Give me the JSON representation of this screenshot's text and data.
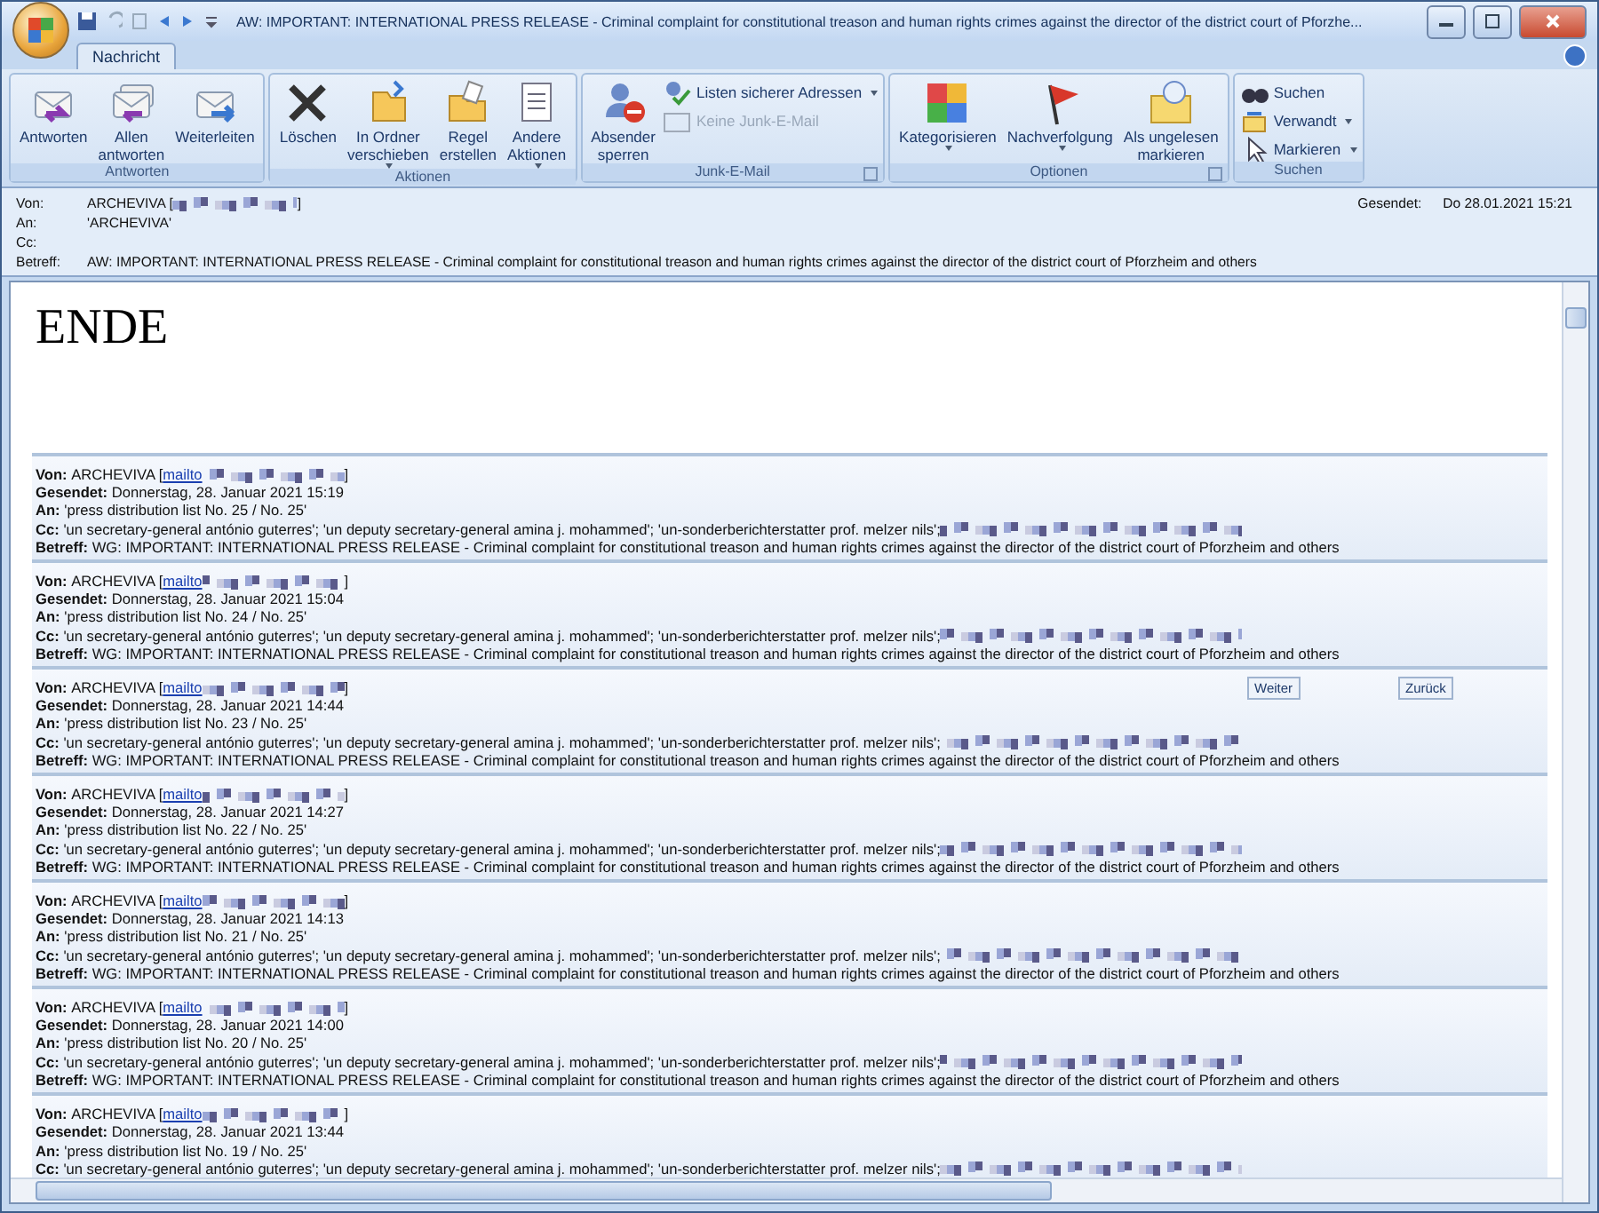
{
  "window": {
    "title": "AW: IMPORTANT:  INTERNATIONAL PRESS RELEASE  -  Criminal complaint for constitutional treason and human rights crimes against the director of the district court of Pforzhe..."
  },
  "tabs": [
    {
      "label": "Nachricht",
      "selected": true
    }
  ],
  "ribbon": [
    {
      "label": "Antworten",
      "launcher": false,
      "buttons": [
        {
          "kind": "reply",
          "label": "Antworten",
          "menu": false,
          "disabled": false
        },
        {
          "kind": "reply-all",
          "label": "Allen\nantworten",
          "menu": false,
          "disabled": false
        },
        {
          "kind": "forward",
          "label": "Weiterleiten",
          "menu": false,
          "disabled": false
        }
      ]
    },
    {
      "label": "Aktionen",
      "launcher": false,
      "buttons": [
        {
          "kind": "delete",
          "label": "Löschen",
          "menu": false,
          "disabled": false
        },
        {
          "kind": "move",
          "label": "In Ordner\nverschieben",
          "menu": true,
          "disabled": false
        },
        {
          "kind": "rule",
          "label": "Regel\nerstellen",
          "menu": false,
          "disabled": false
        },
        {
          "kind": "other",
          "label": "Andere\nAktionen",
          "menu": true,
          "disabled": false
        }
      ]
    },
    {
      "label": "Junk-E-Mail",
      "launcher": true,
      "buttons": [
        {
          "kind": "block",
          "label": "Absender\nsperren",
          "menu": false,
          "disabled": false
        }
      ],
      "small": [
        {
          "kind": "safe",
          "label": "Listen sicherer Adressen",
          "menu": true,
          "disabled": false
        },
        {
          "kind": "notjunk",
          "label": "Keine Junk-E-Mail",
          "menu": false,
          "disabled": true
        }
      ]
    },
    {
      "label": "Optionen",
      "launcher": true,
      "buttons": [
        {
          "kind": "categorize",
          "label": "Kategorisieren",
          "menu": true,
          "disabled": false
        },
        {
          "kind": "flag",
          "label": "Nachverfolgung",
          "menu": true,
          "disabled": false
        },
        {
          "kind": "unread",
          "label": "Als ungelesen\nmarkieren",
          "menu": false,
          "disabled": false
        }
      ]
    },
    {
      "label": "Suchen",
      "launcher": false,
      "small": [
        {
          "kind": "find",
          "label": "Suchen",
          "menu": false,
          "disabled": false
        },
        {
          "kind": "related",
          "label": "Verwandt",
          "menu": true,
          "disabled": false
        },
        {
          "kind": "select",
          "label": "Markieren",
          "menu": true,
          "disabled": false
        }
      ]
    }
  ],
  "header": {
    "from_label": "Von:",
    "from": "ARCHEVIVA [",
    "from_end": "]",
    "to_label": "An:",
    "to": "'ARCHEVIVA'",
    "cc_label": "Cc:",
    "subject_label": "Betreff:",
    "subject": "AW: IMPORTANT:  INTERNATIONAL PRESS RELEASE  -  Criminal complaint for constitutional treason and human rights crimes against the director of the district court of Pforzheim and others",
    "sent_label": "Gesendet:",
    "sent": "Do 28.01.2021 15:21"
  },
  "body_heading": "ENDE",
  "nav_buttons": [
    "Weiter",
    "Zurück"
  ],
  "messages": [
    {
      "from_label": "Von:",
      "from": "ARCHEVIVA [",
      "link": "mailto",
      "from_end": "]",
      "sent_label": "Gesendet:",
      "sent": "Donnerstag, 28. Januar 2021 15:19",
      "to_label": "An:",
      "to": "'press distribution list No. 25 / No. 25'",
      "cc_label": "Cc:",
      "cc": "'un secretary-general antónio guterres'; 'un deputy secretary-general amina j. mohammed'; 'un-sonderberichterstatter prof. melzer nils';",
      "subject_label": "Betreff:",
      "subject": "WG: IMPORTANT: INTERNATIONAL PRESS RELEASE - Criminal complaint for constitutional treason and human rights crimes against the director of the district court of Pforzheim and others"
    },
    {
      "from_label": "Von:",
      "from": "ARCHEVIVA [",
      "link": "mailto",
      "from_end": "]",
      "sent_label": "Gesendet:",
      "sent": "Donnerstag, 28. Januar 2021 15:04",
      "to_label": "An:",
      "to": "'press distribution list No. 24 / No. 25'",
      "cc_label": "Cc:",
      "cc": "'un secretary-general antónio guterres'; 'un deputy secretary-general amina j. mohammed'; 'un-sonderberichterstatter prof. melzer nils';",
      "subject_label": "Betreff:",
      "subject": "WG: IMPORTANT: INTERNATIONAL PRESS RELEASE - Criminal complaint for constitutional treason and human rights crimes against the director of the district court of Pforzheim and others"
    },
    {
      "from_label": "Von:",
      "from": "ARCHEVIVA [",
      "link": "mailto",
      "from_end": "]",
      "sent_label": "Gesendet:",
      "sent": "Donnerstag, 28. Januar 2021 14:44",
      "to_label": "An:",
      "to": "'press distribution list No. 23 / No. 25'",
      "cc_label": "Cc:",
      "cc": "'un secretary-general antónio guterres'; 'un deputy secretary-general amina j. mohammed'; 'un-sonderberichterstatter prof. melzer nils';",
      "subject_label": "Betreff:",
      "subject": "WG: IMPORTANT: INTERNATIONAL PRESS RELEASE - Criminal complaint for constitutional treason and human rights crimes against the director of the district court of Pforzheim and others"
    },
    {
      "from_label": "Von:",
      "from": "ARCHEVIVA [",
      "link": "mailto",
      "from_end": "]",
      "sent_label": "Gesendet:",
      "sent": "Donnerstag, 28. Januar 2021 14:27",
      "to_label": "An:",
      "to": "'press distribution list No. 22 / No. 25'",
      "cc_label": "Cc:",
      "cc": "'un secretary-general antónio guterres'; 'un deputy secretary-general amina j. mohammed'; 'un-sonderberichterstatter prof. melzer nils';",
      "subject_label": "Betreff:",
      "subject": "WG: IMPORTANT: INTERNATIONAL PRESS RELEASE - Criminal complaint for constitutional treason and human rights crimes against the director of the district court of Pforzheim and others"
    },
    {
      "from_label": "Von:",
      "from": "ARCHEVIVA [",
      "link": "mailto",
      "from_end": "]",
      "sent_label": "Gesendet:",
      "sent": "Donnerstag, 28. Januar 2021 14:13",
      "to_label": "An:",
      "to": "'press distribution list No. 21 / No. 25'",
      "cc_label": "Cc:",
      "cc": "'un secretary-general antónio guterres'; 'un deputy secretary-general amina j. mohammed'; 'un-sonderberichterstatter prof. melzer nils';",
      "subject_label": "Betreff:",
      "subject": "WG: IMPORTANT: INTERNATIONAL PRESS RELEASE - Criminal complaint for constitutional treason and human rights crimes against the director of the district court of Pforzheim and others"
    },
    {
      "from_label": "Von:",
      "from": "ARCHEVIVA [",
      "link": "mailto",
      "from_end": "]",
      "sent_label": "Gesendet:",
      "sent": "Donnerstag, 28. Januar 2021 14:00",
      "to_label": "An:",
      "to": "'press distribution list No. 20 / No. 25'",
      "cc_label": "Cc:",
      "cc": "'un secretary-general antónio guterres'; 'un deputy secretary-general amina j. mohammed'; 'un-sonderberichterstatter prof. melzer nils';",
      "subject_label": "Betreff:",
      "subject": "WG: IMPORTANT: INTERNATIONAL PRESS RELEASE - Criminal complaint for constitutional treason and human rights crimes against the director of the district court of Pforzheim and others"
    },
    {
      "from_label": "Von:",
      "from": "ARCHEVIVA [",
      "link": "mailto",
      "from_end": "]",
      "sent_label": "Gesendet:",
      "sent": "Donnerstag, 28. Januar 2021 13:44",
      "to_label": "An:",
      "to": "'press distribution list No. 19 / No. 25'",
      "cc_label": "Cc:",
      "cc": "'un secretary-general antónio guterres'; 'un deputy secretary-general amina j. mohammed'; 'un-sonderberichterstatter prof. melzer nils';"
    }
  ]
}
